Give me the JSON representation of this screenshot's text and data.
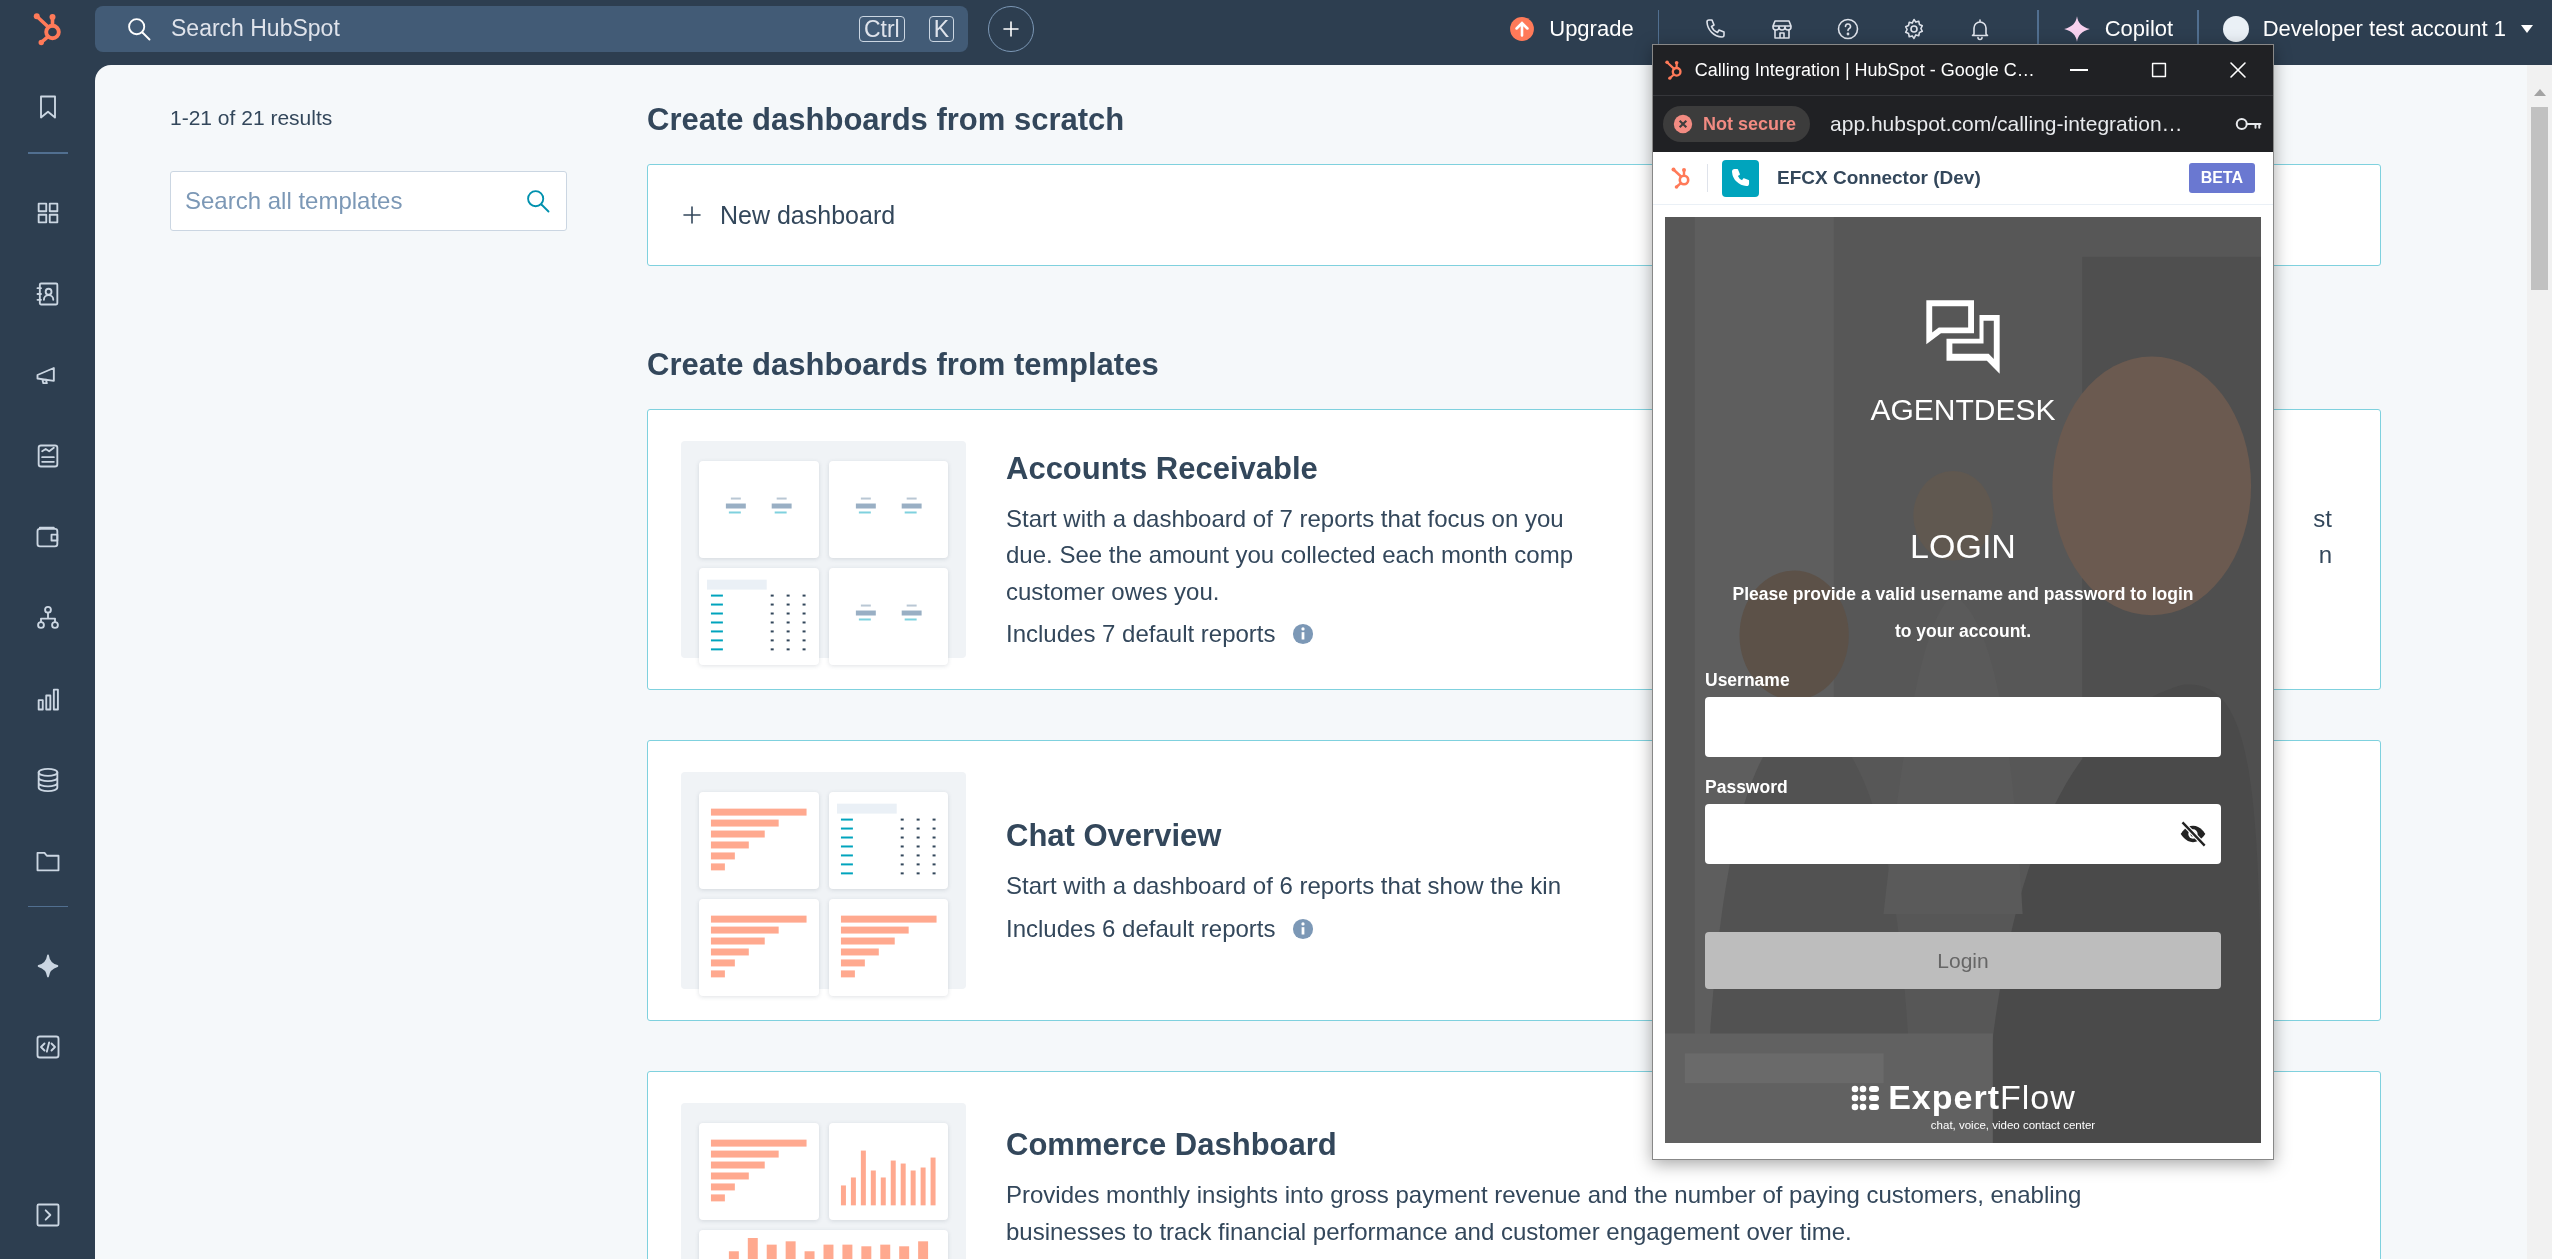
{
  "topbar": {
    "search": {
      "placeholder": "Search HubSpot"
    },
    "shortcut_keys": [
      "Ctrl",
      "K"
    ],
    "upgrade": "Upgrade",
    "copilot": "Copilot",
    "account": "Developer test account 1"
  },
  "results_count": "1-21 of 21 results",
  "template_search": {
    "placeholder": "Search all templates"
  },
  "scratch": {
    "heading": "Create dashboards from scratch",
    "new_dashboard": "New dashboard"
  },
  "templates": {
    "heading": "Create dashboards from templates",
    "cards": [
      {
        "title": "Accounts Receivable",
        "lines": [
          {
            "text": "Start with a dashboard of 7 reports that focus on you",
            "tail": "st"
          },
          {
            "text": "due. See the amount you collected each month comp",
            "tail": "n"
          },
          {
            "text": "customer owes you."
          }
        ],
        "reports": "Includes 7 default reports",
        "tiles": [
          {
            "kind": "kpi"
          },
          {
            "kind": "kpi"
          },
          {
            "kind": "table"
          },
          {
            "kind": "kpi"
          }
        ]
      },
      {
        "title": "Chat Overview",
        "lines": [
          {
            "text": "Start with a dashboard of 6 reports that show the kin"
          }
        ],
        "reports": "Includes 6 default reports",
        "tiles": [
          {
            "kind": "hbar"
          },
          {
            "kind": "table"
          },
          {
            "kind": "hbar"
          },
          {
            "kind": "hbar"
          }
        ]
      },
      {
        "title": "Commerce Dashboard",
        "lines": [
          {
            "text": "Provides monthly insights into gross payment revenue and the number of paying customers, enabling"
          },
          {
            "text": "businesses to track financial performance and customer engagement over time."
          }
        ],
        "tiles": [
          {
            "kind": "hbar"
          },
          {
            "kind": "vbar"
          },
          {
            "kind": "vbar_wide"
          }
        ]
      }
    ]
  },
  "popup": {
    "title": "Calling Integration | HubSpot - Google C…",
    "security": "Not secure",
    "url": "app.hubspot.com/calling-integration…",
    "app_name": "EFCX Connector (Dev)",
    "badge": "BETA",
    "brand": "AGENTDESK",
    "heading": "LOGIN",
    "message": "Please provide a valid username and password to login to your account.",
    "fields": [
      {
        "label": "Username",
        "kind": "text"
      },
      {
        "label": "Password",
        "kind": "password"
      }
    ],
    "login_button": {
      "label": "Login",
      "disabled": true
    },
    "logo": "**Expert**Flow",
    "tagline": "chat, voice, video contact center"
  }
}
